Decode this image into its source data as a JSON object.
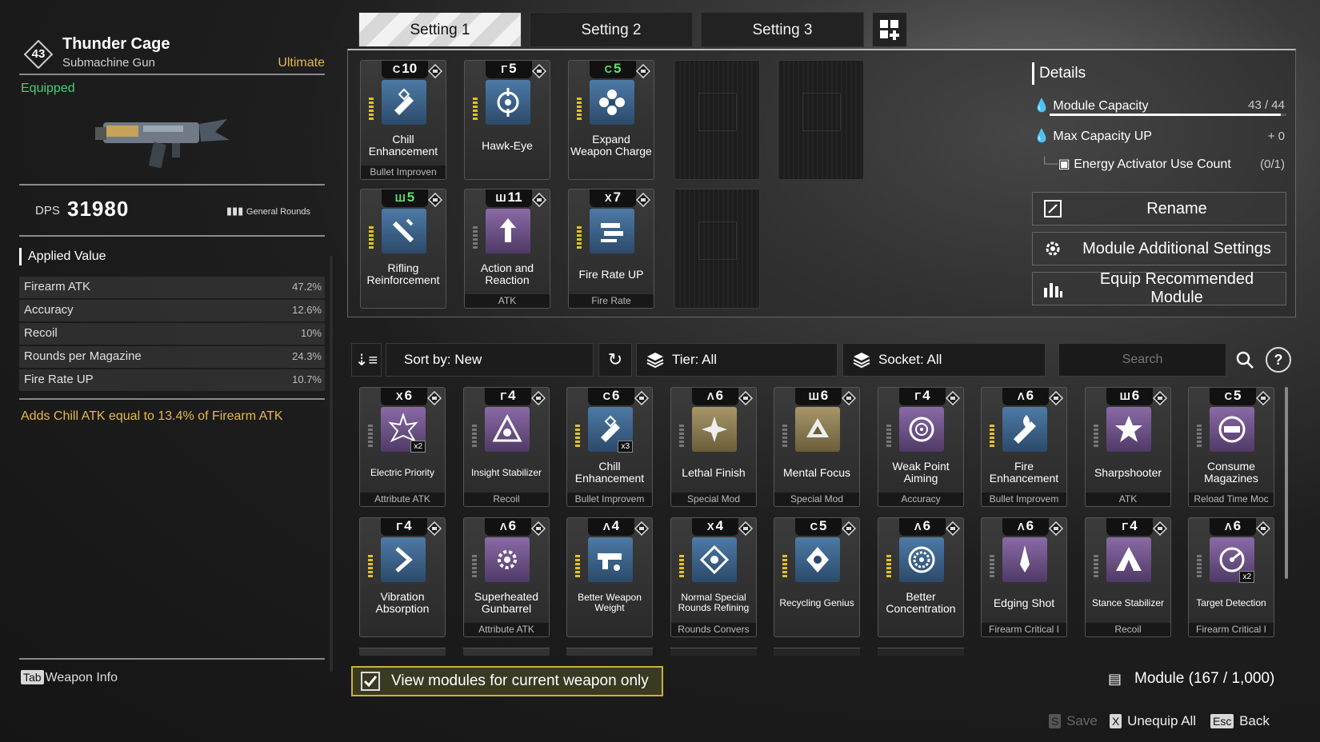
{
  "weapon": {
    "level": "43",
    "name": "Thunder Cage",
    "type": "Submachine Gun",
    "grade": "Ultimate",
    "status": "Equipped",
    "dps_label": "DPS",
    "dps_value": "31980",
    "rounds": "General Rounds"
  },
  "applied": {
    "title": "Applied Value",
    "stats": [
      {
        "name": "Firearm ATK",
        "value": "47.2%"
      },
      {
        "name": "Accuracy",
        "value": "12.6%"
      },
      {
        "name": "Recoil",
        "value": "10%"
      },
      {
        "name": "Rounds per Magazine",
        "value": "24.3%"
      },
      {
        "name": "Fire Rate UP",
        "value": "10.7%"
      }
    ],
    "effect": "Adds Chill ATK equal to 13.4% of Firearm ATK"
  },
  "weapon_info": {
    "key": "Tab",
    "label": "Weapon Info"
  },
  "tabs": [
    {
      "label": "Setting 1",
      "active": true
    },
    {
      "label": "Setting 2",
      "active": false
    },
    {
      "label": "Setting 3",
      "active": false
    }
  ],
  "equipped_modules": [
    {
      "cost": "10",
      "socket_sym": "C",
      "name": "Chill Enhancement",
      "socket": "Bullet Improven",
      "color": "blue",
      "icon": "chill-icon",
      "green": false
    },
    {
      "cost": "5",
      "socket_sym": "Γ",
      "name": "Hawk-Eye",
      "socket": "",
      "color": "blue",
      "icon": "crosshair-icon",
      "green": false
    },
    {
      "cost": "5",
      "socket_sym": "C",
      "name": "Expand Weapon Charge",
      "socket": "",
      "color": "blue",
      "icon": "flower-icon",
      "green": true
    },
    {
      "cost": "5",
      "socket_sym": "Ш",
      "name": "Rifling Reinforcement",
      "socket": "",
      "color": "blue",
      "icon": "rifling-icon",
      "green": true
    },
    {
      "cost": "11",
      "socket_sym": "Ш",
      "name": "Action and Reaction",
      "socket": "ATK",
      "color": "purple",
      "icon": "arrows-icon",
      "green": false
    },
    {
      "cost": "7",
      "socket_sym": "X",
      "name": "Fire Rate UP",
      "socket": "Fire Rate",
      "color": "blue",
      "icon": "bullets-icon",
      "green": false
    }
  ],
  "details": {
    "title": "Details",
    "capacity_label": "Module Capacity",
    "capacity_value": "43 / 44",
    "capacity_fraction": 0.977,
    "max_label": "Max Capacity UP",
    "max_value": "+ 0",
    "activator_label": "Energy Activator Use Count",
    "activator_value": "(0/1)"
  },
  "actions": {
    "rename": "Rename",
    "additional": "Module Additional Settings",
    "recommend": "Equip Recommended Module"
  },
  "filters": {
    "sort": "Sort by: New",
    "tier": "Tier: All",
    "socket": "Socket: All",
    "search_placeholder": "Search",
    "help": "?"
  },
  "inventory": [
    {
      "cost": "6",
      "socket_sym": "X",
      "name": "Electric Priority",
      "socket": "Attribute ATK",
      "color": "purple",
      "icon": "spark-icon",
      "mult": "x2",
      "small": true
    },
    {
      "cost": "4",
      "socket_sym": "Γ",
      "name": "Insight Stabilizer",
      "socket": "Recoil",
      "color": "purple",
      "icon": "triangle-icon",
      "mult": "",
      "small": true
    },
    {
      "cost": "6",
      "socket_sym": "C",
      "name": "Chill Enhancement",
      "socket": "Bullet Improvem",
      "color": "blue",
      "icon": "chill-icon",
      "mult": "x3",
      "small": false
    },
    {
      "cost": "6",
      "socket_sym": "Λ",
      "name": "Lethal Finish",
      "socket": "Special Mod",
      "color": "gold",
      "icon": "burst-icon",
      "mult": "",
      "small": false
    },
    {
      "cost": "6",
      "socket_sym": "Ш",
      "name": "Mental Focus",
      "socket": "Special Mod",
      "color": "gold",
      "icon": "focus-icon",
      "mult": "",
      "small": false
    },
    {
      "cost": "4",
      "socket_sym": "Γ",
      "name": "Weak Point Aiming",
      "socket": "Accuracy",
      "color": "purple",
      "icon": "target-icon",
      "mult": "",
      "small": false
    },
    {
      "cost": "6",
      "socket_sym": "Λ",
      "name": "Fire Enhancement",
      "socket": "Bullet Improvem",
      "color": "blue",
      "icon": "fire-icon",
      "mult": "",
      "small": false
    },
    {
      "cost": "6",
      "socket_sym": "Ш",
      "name": "Sharpshooter",
      "socket": "ATK",
      "color": "purple",
      "icon": "star-icon",
      "mult": "",
      "small": false
    },
    {
      "cost": "5",
      "socket_sym": "C",
      "name": "Consume Magazines",
      "socket": "Reload Time Moc",
      "color": "purple",
      "icon": "magazine-icon",
      "mult": "",
      "small": false
    },
    {
      "cost": "4",
      "socket_sym": "Γ",
      "name": "Vibration Absorption",
      "socket": "",
      "color": "blue",
      "icon": "chevron-icon",
      "mult": "",
      "small": false
    },
    {
      "cost": "6",
      "socket_sym": "Λ",
      "name": "Superheated Gunbarrel",
      "socket": "Attribute ATK",
      "color": "purple",
      "icon": "gear-burst-icon",
      "mult": "",
      "small": false
    },
    {
      "cost": "4",
      "socket_sym": "Λ",
      "name": "Better Weapon Weight",
      "socket": "",
      "color": "blue",
      "icon": "gun-icon",
      "mult": "",
      "small": true
    },
    {
      "cost": "4",
      "socket_sym": "X",
      "name": "Normal Special Rounds Refining",
      "socket": "Rounds Convers",
      "color": "blue",
      "icon": "rounds-icon",
      "mult": "",
      "small": true
    },
    {
      "cost": "5",
      "socket_sym": "C",
      "name": "Recycling Genius",
      "socket": "",
      "color": "blue",
      "icon": "recycle-icon",
      "mult": "",
      "small": true
    },
    {
      "cost": "6",
      "socket_sym": "Λ",
      "name": "Better Concentration",
      "socket": "",
      "color": "blue",
      "icon": "concentric-icon",
      "mult": "",
      "small": false
    },
    {
      "cost": "6",
      "socket_sym": "Λ",
      "name": "Edging Shot",
      "socket": "Firearm Critical I",
      "color": "purple",
      "icon": "blade-icon",
      "mult": "",
      "small": false
    },
    {
      "cost": "4",
      "socket_sym": "Γ",
      "name": "Stance Stabilizer",
      "socket": "Recoil",
      "color": "purple",
      "icon": "peak-icon",
      "mult": "",
      "small": true
    },
    {
      "cost": "6",
      "socket_sym": "Λ",
      "name": "Target Detection",
      "socket": "Firearm Critical I",
      "color": "purple",
      "icon": "radar-icon",
      "mult": "x2",
      "small": true
    }
  ],
  "bottom": {
    "view_only": "View modules for current weapon only",
    "module_count": "Module (167 / 1,000)",
    "save_key": "S",
    "save": "Save",
    "unequip_key": "X",
    "unequip": "Unequip All",
    "back_key": "Esc",
    "back": "Back"
  },
  "colors": {
    "gold": "#e6b84e",
    "green": "#3fd07a",
    "accent": "#c9b23a"
  }
}
